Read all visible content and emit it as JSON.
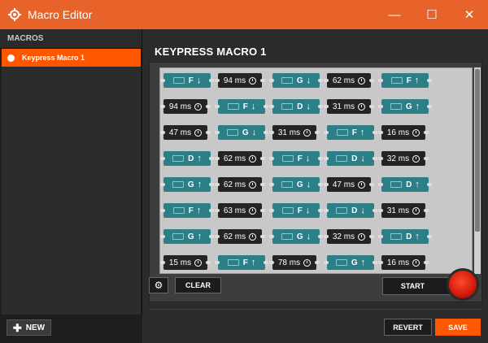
{
  "window": {
    "title": "Macro Editor",
    "min_icon": "minimize-icon",
    "max_icon": "maximize-icon",
    "close_icon": "close-icon",
    "accent": "#e8632a"
  },
  "sidebar": {
    "header": "MACROS",
    "items": [
      {
        "label": "Keypress Macro 1",
        "selected": true
      }
    ],
    "new_label": "NEW"
  },
  "editor": {
    "title": "KEYPRESS MACRO 1",
    "rows": [
      [
        {
          "type": "key",
          "key": "F",
          "dir": "down"
        },
        {
          "type": "delay",
          "ms": "94 ms"
        },
        {
          "type": "key",
          "key": "G",
          "dir": "down"
        },
        {
          "type": "delay",
          "ms": "62 ms"
        },
        {
          "type": "key",
          "key": "F",
          "dir": "up"
        }
      ],
      [
        {
          "type": "delay",
          "ms": "94 ms"
        },
        {
          "type": "key",
          "key": "F",
          "dir": "down"
        },
        {
          "type": "key",
          "key": "D",
          "dir": "down"
        },
        {
          "type": "delay",
          "ms": "31 ms"
        },
        {
          "type": "key",
          "key": "G",
          "dir": "up"
        }
      ],
      [
        {
          "type": "delay",
          "ms": "47 ms"
        },
        {
          "type": "key",
          "key": "G",
          "dir": "down"
        },
        {
          "type": "delay",
          "ms": "31 ms"
        },
        {
          "type": "key",
          "key": "F",
          "dir": "up"
        },
        {
          "type": "delay",
          "ms": "16 ms"
        }
      ],
      [
        {
          "type": "key",
          "key": "D",
          "dir": "up"
        },
        {
          "type": "delay",
          "ms": "62 ms"
        },
        {
          "type": "key",
          "key": "F",
          "dir": "down"
        },
        {
          "type": "key",
          "key": "D",
          "dir": "down"
        },
        {
          "type": "delay",
          "ms": "32 ms"
        }
      ],
      [
        {
          "type": "key",
          "key": "G",
          "dir": "up"
        },
        {
          "type": "delay",
          "ms": "62 ms"
        },
        {
          "type": "key",
          "key": "G",
          "dir": "down"
        },
        {
          "type": "delay",
          "ms": "47 ms"
        },
        {
          "type": "key",
          "key": "D",
          "dir": "up"
        }
      ],
      [
        {
          "type": "key",
          "key": "F",
          "dir": "up"
        },
        {
          "type": "delay",
          "ms": "63 ms"
        },
        {
          "type": "key",
          "key": "F",
          "dir": "down"
        },
        {
          "type": "key",
          "key": "D",
          "dir": "down"
        },
        {
          "type": "delay",
          "ms": "31 ms"
        }
      ],
      [
        {
          "type": "key",
          "key": "G",
          "dir": "up"
        },
        {
          "type": "delay",
          "ms": "62 ms"
        },
        {
          "type": "key",
          "key": "G",
          "dir": "down"
        },
        {
          "type": "delay",
          "ms": "32 ms"
        },
        {
          "type": "key",
          "key": "D",
          "dir": "up"
        }
      ],
      [
        {
          "type": "delay",
          "ms": "15 ms"
        },
        {
          "type": "key",
          "key": "F",
          "dir": "up"
        },
        {
          "type": "delay",
          "ms": "78 ms"
        },
        {
          "type": "key",
          "key": "G",
          "dir": "up"
        },
        {
          "type": "delay",
          "ms": "16 ms"
        }
      ]
    ],
    "clear_label": "CLEAR",
    "start_label": "START",
    "settings_icon": "gear-icon",
    "record_icon": "record-icon"
  },
  "footer": {
    "revert_label": "REVERT",
    "save_label": "SAVE",
    "save_color": "#ff5700"
  }
}
